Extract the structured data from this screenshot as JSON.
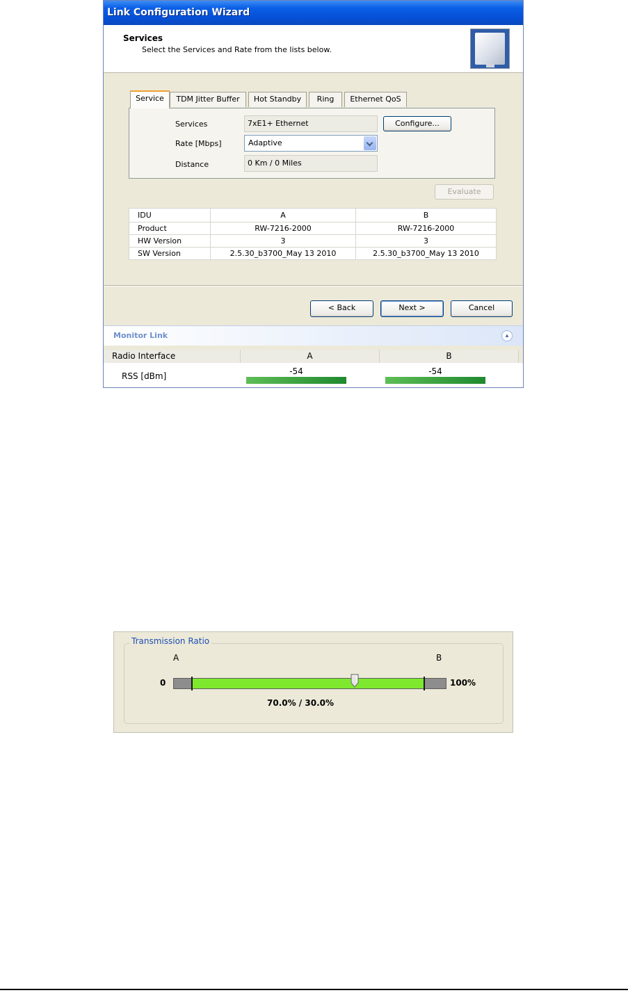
{
  "wizard": {
    "title": "Link Configuration Wizard",
    "header_title": "Services",
    "header_subtitle": "Select the Services and Rate from the lists below.",
    "tabs": [
      {
        "label": "Service",
        "active": true
      },
      {
        "label": "TDM Jitter Buffer",
        "active": false
      },
      {
        "label": "Hot Standby",
        "active": false
      },
      {
        "label": "Ring",
        "active": false
      },
      {
        "label": "Ethernet QoS",
        "active": false
      }
    ],
    "service": {
      "services_label": "Services",
      "services_value": "7xE1+ Ethernet",
      "configure_label": "Configure...",
      "rate_label": "Rate [Mbps]",
      "rate_value": "Adaptive",
      "distance_label": "Distance",
      "distance_value": "0 Km / 0 Miles"
    },
    "evaluate_label": "Evaluate",
    "idu_table": {
      "headers": [
        "IDU",
        "A",
        "B"
      ],
      "rows": [
        [
          "Product",
          "RW-7216-2000",
          "RW-7216-2000"
        ],
        [
          "HW Version",
          "3",
          "3"
        ],
        [
          "SW Version",
          "2.5.30_b3700_May 13 2010",
          "2.5.30_b3700_May 13 2010"
        ]
      ]
    },
    "buttons": {
      "back": "< Back",
      "next": "Next >",
      "cancel": "Cancel"
    },
    "monitor": {
      "title": "Monitor Link",
      "radio_interface_label": "Radio Interface",
      "col_a": "A",
      "col_b": "B",
      "rss_label": "RSS [dBm]",
      "rss_a": "-54",
      "rss_b": "-54"
    }
  },
  "transmission_ratio": {
    "title": "Transmission Ratio",
    "label_a": "A",
    "label_b": "B",
    "min_label": "0",
    "max_label": "100%",
    "ratio_text": "70.0% / 30.0%",
    "a_fraction": 0.7,
    "colors": {
      "fill": "#7ee82f",
      "track": "#8d8d8d"
    }
  }
}
